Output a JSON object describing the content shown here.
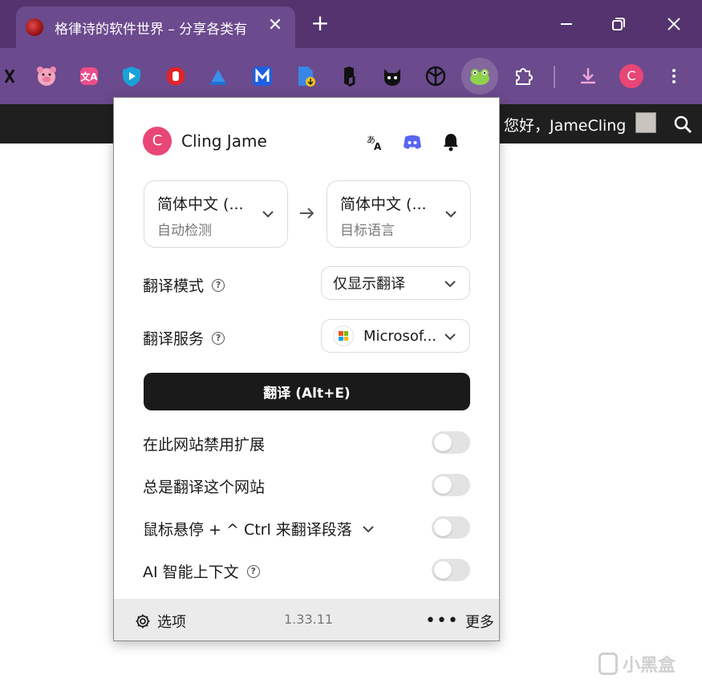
{
  "browser": {
    "tab_title": "格律诗的软件世界 – 分享各类有",
    "tab_close": "✕",
    "new_tab": "+",
    "profile_initial": "C"
  },
  "site": {
    "greeting": "您好，JameCling"
  },
  "popup": {
    "user_initial": "C",
    "user_name": "Cling Jame",
    "source_lang": {
      "name": "简体中文 (...",
      "sub": "自动检测"
    },
    "target_lang": {
      "name": "简体中文 (...",
      "sub": "目标语言"
    },
    "mode": {
      "label": "翻译模式",
      "value": "仅显示翻译"
    },
    "service": {
      "label": "翻译服务",
      "value": "Microsof..."
    },
    "translate_button": "翻译 (Alt+E)",
    "toggles": [
      {
        "label": "在此网站禁用扩展",
        "on": false
      },
      {
        "label": "总是翻译这个网站",
        "on": false
      },
      {
        "label": "鼠标悬停 + ^ Ctrl 来翻译段落",
        "on": false
      },
      {
        "label": "AI 智能上下文",
        "on": false
      }
    ],
    "footer": {
      "options": "选项",
      "version": "1.33.11",
      "more": "更多"
    }
  },
  "watermark": "小黑盒",
  "colors": {
    "tabbar": "#55336e",
    "toolbar": "#6b4a8d",
    "accent_avatar": "#e84676",
    "button_dark": "#1a1a1a"
  }
}
